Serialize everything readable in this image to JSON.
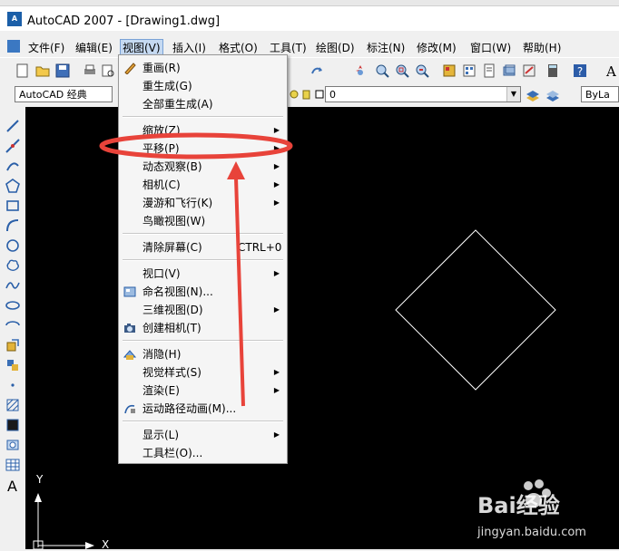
{
  "window": {
    "title": "AutoCAD 2007 - [Drawing1.dwg]",
    "app_icon_text": "A"
  },
  "menubar": {
    "items": [
      {
        "label": "文件(F)"
      },
      {
        "label": "编辑(E)"
      },
      {
        "label": "视图(V)"
      },
      {
        "label": "插入(I)"
      },
      {
        "label": "格式(O)"
      },
      {
        "label": "工具(T)"
      },
      {
        "label": "绘图(D)"
      },
      {
        "label": "标注(N)"
      },
      {
        "label": "修改(M)"
      },
      {
        "label": "窗口(W)"
      },
      {
        "label": "帮助(H)"
      }
    ]
  },
  "toolbar2": {
    "workspace": "AutoCAD 经典",
    "layer": "0",
    "linetype": "ByLa"
  },
  "view_menu": {
    "items": [
      {
        "label": "重画(R)",
        "shortcut": "",
        "submenu": false
      },
      {
        "label": "重生成(G)",
        "shortcut": "",
        "submenu": false
      },
      {
        "label": "全部重生成(A)",
        "shortcut": "",
        "submenu": false
      },
      {
        "label": "缩放(Z)",
        "shortcut": "",
        "submenu": true
      },
      {
        "label": "平移(P)",
        "shortcut": "",
        "submenu": true
      },
      {
        "label": "动态观察(B)",
        "shortcut": "",
        "submenu": true
      },
      {
        "label": "相机(C)",
        "shortcut": "",
        "submenu": true
      },
      {
        "label": "漫游和飞行(K)",
        "shortcut": "",
        "submenu": true
      },
      {
        "label": "鸟瞰视图(W)",
        "shortcut": "",
        "submenu": false
      },
      {
        "label": "清除屏幕(C)",
        "shortcut": "CTRL+0",
        "submenu": false
      },
      {
        "label": "视口(V)",
        "shortcut": "",
        "submenu": true
      },
      {
        "label": "命名视图(N)...",
        "shortcut": "",
        "submenu": false
      },
      {
        "label": "三维视图(D)",
        "shortcut": "",
        "submenu": true
      },
      {
        "label": "创建相机(T)",
        "shortcut": "",
        "submenu": false
      },
      {
        "label": "消隐(H)",
        "shortcut": "",
        "submenu": false
      },
      {
        "label": "视觉样式(S)",
        "shortcut": "",
        "submenu": true
      },
      {
        "label": "渲染(E)",
        "shortcut": "",
        "submenu": true
      },
      {
        "label": "运动路径动画(M)...",
        "shortcut": "",
        "submenu": false
      },
      {
        "label": "显示(L)",
        "shortcut": "",
        "submenu": true
      },
      {
        "label": "工具栏(O)...",
        "shortcut": "",
        "submenu": false
      }
    ]
  },
  "ucs": {
    "y_label": "Y",
    "x_label": "X"
  },
  "watermark": {
    "brand": "Bai经验",
    "url": "jingyan.baidu.com"
  },
  "colors": {
    "canvas": "#000000",
    "highlight_ring": "#e8433a",
    "menu_active": "#c5d9f1"
  }
}
